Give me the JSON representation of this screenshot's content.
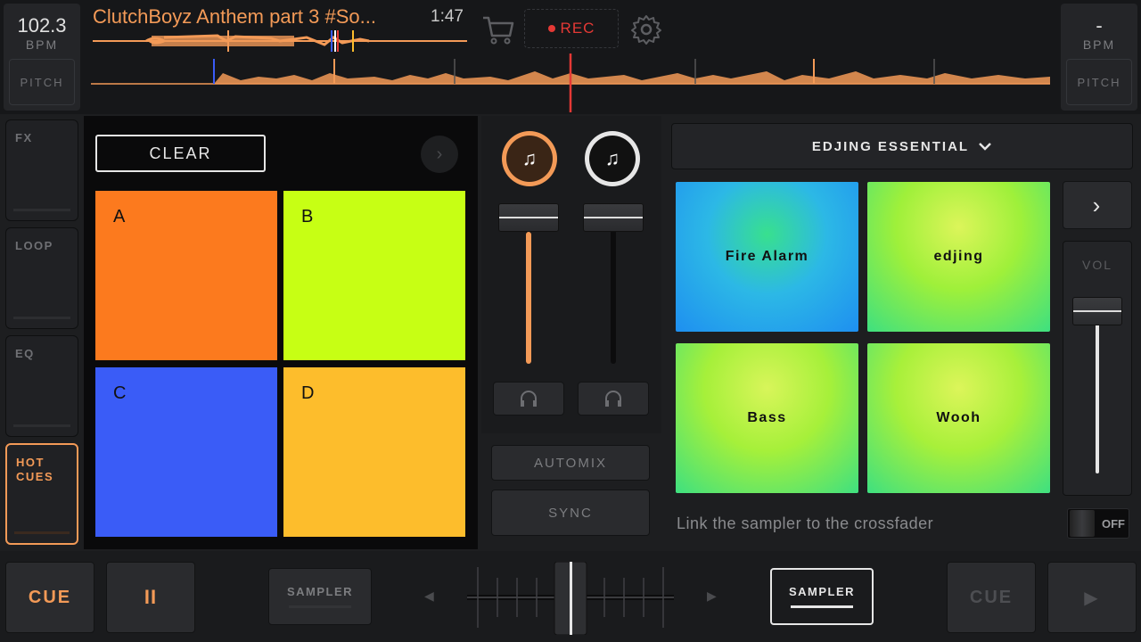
{
  "left_deck": {
    "bpm": "102.3",
    "bpm_label": "BPM",
    "pitch_label": "PITCH",
    "track_title": "ClutchBoyz Anthem part 3 #So...",
    "time": "1:47"
  },
  "right_deck": {
    "bpm": "-",
    "bpm_label": "BPM",
    "pitch_label": "PITCH"
  },
  "toolbar": {
    "cart_icon": "shopping-cart-icon",
    "rec_label": "REC",
    "settings_icon": "gear-icon"
  },
  "side_tabs": [
    {
      "label": "FX",
      "active": false
    },
    {
      "label": "LOOP",
      "active": false
    },
    {
      "label": "EQ",
      "active": false
    },
    {
      "label": "HOT CUES",
      "active": true
    }
  ],
  "hot_cues": {
    "clear_label": "CLEAR",
    "next_icon": "chevron-right-icon",
    "pads": [
      {
        "label": "A",
        "color": "#fc7a1e"
      },
      {
        "label": "B",
        "color": "#c7ff14"
      },
      {
        "label": "C",
        "color": "#3a5cf7"
      },
      {
        "label": "D",
        "color": "#fdbd2c"
      }
    ]
  },
  "mixer": {
    "left_channel_color": "#f5a25d",
    "left_level": 0.88,
    "right_level": 0.0,
    "automix_label": "AUTOMIX",
    "sync_label": "SYNC"
  },
  "sampler": {
    "pack_label": "EDJING ESSENTIAL",
    "next_label": "›",
    "vol_label": "VOL",
    "pads": [
      {
        "label": "Fire Alarm"
      },
      {
        "label": "edjing"
      },
      {
        "label": "Bass"
      },
      {
        "label": "Wooh"
      }
    ],
    "link_text": "Link the sampler to the crossfader",
    "toggle_label": "OFF"
  },
  "bottom": {
    "left_cue": "CUE",
    "left_play_pause": "II",
    "left_sampler": "SAMPLER",
    "right_sampler": "SAMPLER",
    "right_cue": "CUE",
    "right_play": "▶",
    "left_arrow": "◀",
    "right_arrow": "▶"
  },
  "colors": {
    "accent_orange": "#f39a57",
    "rec_red": "#e53935"
  }
}
